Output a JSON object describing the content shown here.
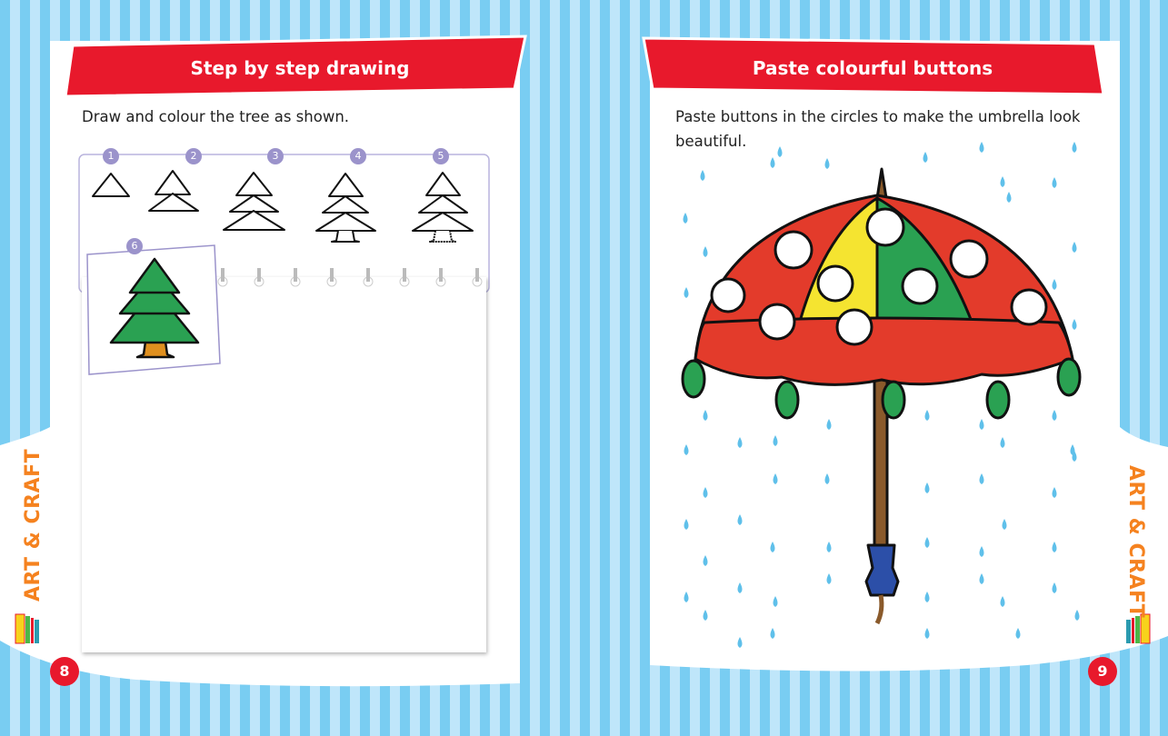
{
  "left_page": {
    "banner_title": "Step by step drawing",
    "instruction": "Draw and colour the tree as shown.",
    "steps": [
      "1",
      "2",
      "3",
      "4",
      "5",
      "6"
    ],
    "side_label": "ART & CRAFT",
    "page_number": "8"
  },
  "right_page": {
    "banner_title": "Paste colourful buttons",
    "instruction_line1": "Paste buttons in the circles to make the umbrella look",
    "instruction_line2": "beautiful.",
    "side_label": "ART & CRAFT",
    "page_number": "9"
  },
  "colors": {
    "banner_red": "#e8192c",
    "stripe_dark": "#79cdf2",
    "stripe_light": "#bfe6fa",
    "accent_orange": "#f5821f",
    "step_purple": "#9b93cb"
  }
}
